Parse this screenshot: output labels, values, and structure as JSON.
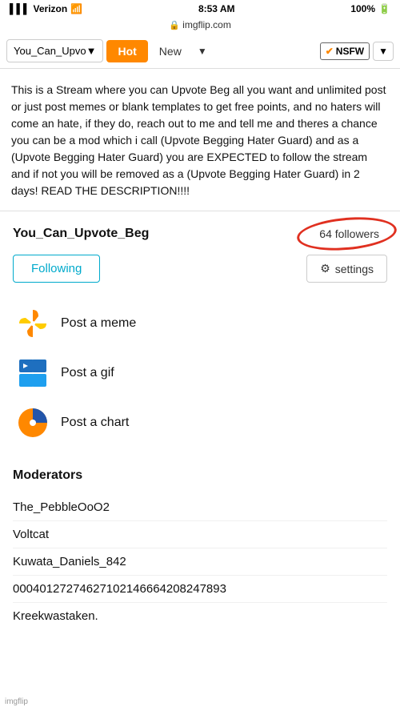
{
  "statusBar": {
    "carrier": "Verizon",
    "time": "8:53 AM",
    "battery": "100%"
  },
  "urlBar": {
    "url": "imgflip.com"
  },
  "navBar": {
    "streamDropdown": "You_Can_Upvo▼",
    "hotLabel": "Hot",
    "newLabel": "New",
    "nsfwLabel": "NSFW"
  },
  "description": {
    "text": "This is a Stream where you can Upvote Beg all you want and unlimited post or just post memes or blank templates to get free points, and no haters will come an hate, if they do, reach out to me and tell me and theres a chance you can be a mod which i call (Upvote Begging Hater Guard) and as a (Upvote Begging Hater Guard) you are EXPECTED to follow the stream and if not you will be removed as a (Upvote Begging Hater Guard) in 2 days! READ THE DESCRIPTION!!!!"
  },
  "stream": {
    "name": "You_Can_Upvote_Beg",
    "followers": "64 followers",
    "followingLabel": "Following",
    "settingsLabel": "settings",
    "postItems": [
      {
        "id": "meme",
        "label": "Post a meme"
      },
      {
        "id": "gif",
        "label": "Post a gif"
      },
      {
        "id": "chart",
        "label": "Post a chart"
      }
    ],
    "moderatorsTitle": "Moderators",
    "moderators": [
      "The_PebbleOoO2",
      "Voltcat",
      "Kuwata_Daniels_842",
      "00040127274627102146664208247893",
      "Kreekwastaken."
    ]
  },
  "watermark": "imgflip"
}
